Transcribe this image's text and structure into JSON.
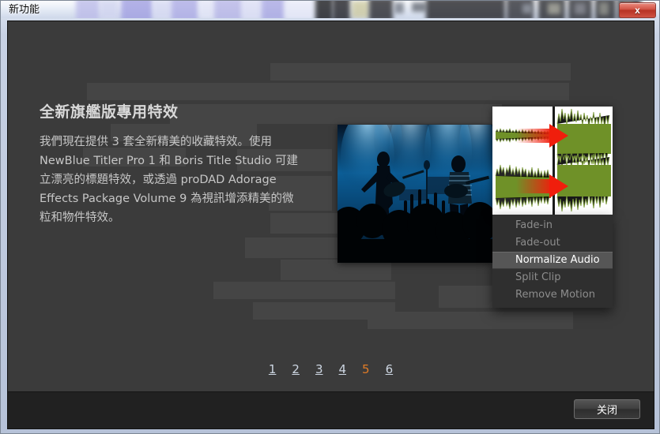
{
  "window": {
    "title": "新功能",
    "close_icon_label": "x"
  },
  "content": {
    "heading": "全新旗艦版專用特效",
    "body": "我們現在提供 3 套全新精美的收藏特效。使用 NewBlue Titler Pro 1 和 Boris Title Studio 可建立漂亮的標題特效，或透過 proDAD Adorage Effects Package Volume 9 為視訊增添精美的微粒和物件特效。"
  },
  "context_menu": {
    "items": [
      {
        "label": "Fade-in",
        "selected": false
      },
      {
        "label": "Fade-out",
        "selected": false
      },
      {
        "label": "Normalize Audio",
        "selected": true
      },
      {
        "label": "Split Clip",
        "selected": false
      },
      {
        "label": "Remove Motion",
        "selected": false
      }
    ]
  },
  "pager": {
    "pages": [
      "1",
      "2",
      "3",
      "4",
      "5",
      "6"
    ],
    "current": "5"
  },
  "footer": {
    "close_label": "关闭"
  },
  "colors": {
    "accent_orange": "#e07b26",
    "link_blue": "#cdd6e2",
    "client_bg": "#3b3b3b",
    "footer_bg": "#212121",
    "menu_bg": "#2f2f2f",
    "menu_selected_bg": "#565656",
    "waveform_green": "#6f9128",
    "arrow_red": "#f01e0c"
  },
  "media": {
    "photo_alt": "concert-silhouette-photo",
    "waveform_alt": "audio-waveform-before-after"
  }
}
